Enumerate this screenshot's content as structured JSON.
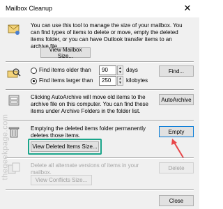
{
  "window": {
    "title": "Mailbox Cleanup",
    "close_glyph": "✕"
  },
  "sections": {
    "view_size": {
      "description": "You can use this tool to manage the size of your mailbox. You can find types of items to delete or move, empty the deleted items folder, or you can have Outlook transfer items to an archive file.",
      "button": "View Mailbox Size..."
    },
    "find": {
      "older_label": "Find items older than",
      "older_value": "90",
      "older_unit": "days",
      "larger_label": "Find items larger than",
      "larger_value": "250",
      "larger_unit": "kilobytes",
      "button": "Find..."
    },
    "autoarchive": {
      "description": "Clicking AutoArchive will move old items to the archive file on this computer. You can find these items under Archive Folders in the folder list.",
      "button": "AutoArchive"
    },
    "deleted_items": {
      "description": "Emptying the deleted items folder permanently deletes those items.",
      "view_button": "View Deleted Items Size...",
      "empty_button": "Empty"
    },
    "conflicts": {
      "description": "Delete all alternate versions of items in your mailbox.",
      "view_button": "View Conflicts Size...",
      "delete_button": "Delete"
    }
  },
  "footer": {
    "close_button": "Close"
  },
  "watermark": "thegeekpage.com",
  "colors": {
    "highlight": "#1aa58a",
    "arrow": "#e8474a",
    "focus": "#0078d7"
  }
}
